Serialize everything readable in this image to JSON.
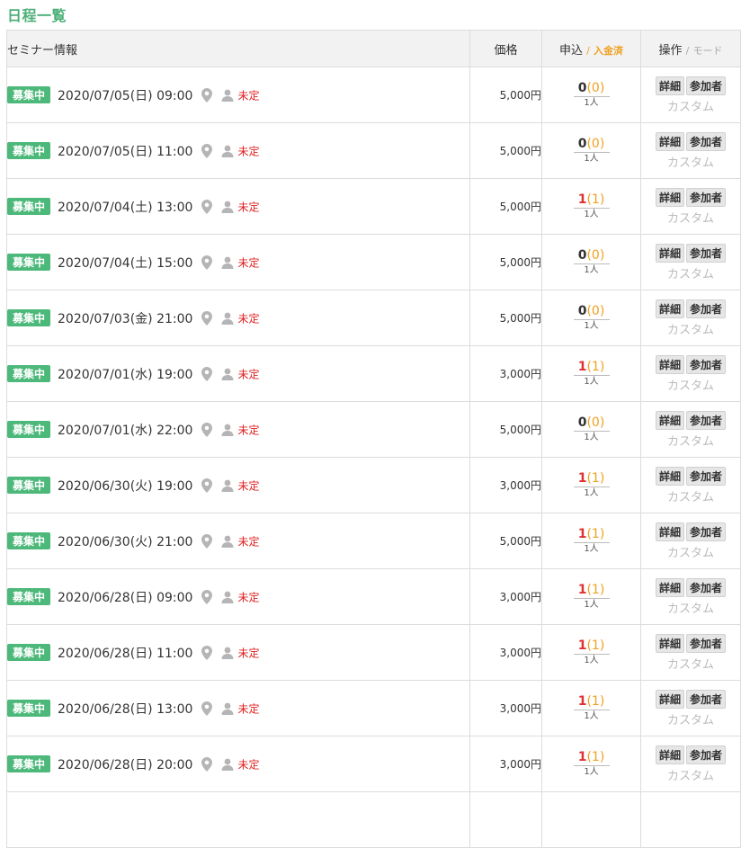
{
  "page": {
    "title": "日程一覧"
  },
  "table": {
    "headers": {
      "info": "セミナー情報",
      "price": "価格",
      "apply": "申込",
      "apply_slash": "/",
      "paid": "入金済",
      "ops": "操作",
      "ops_slash": "/",
      "mode": "モード"
    },
    "rows": [
      {
        "status": "募集中",
        "datetime": "2020/07/05(日) 09:00",
        "instructor": "未定",
        "price": "5,000円",
        "applied": "0",
        "paid": "(0)",
        "unit": "1人"
      },
      {
        "status": "募集中",
        "datetime": "2020/07/05(日) 11:00",
        "instructor": "未定",
        "price": "5,000円",
        "applied": "0",
        "paid": "(0)",
        "unit": "1人"
      },
      {
        "status": "募集中",
        "datetime": "2020/07/04(土) 13:00",
        "instructor": "未定",
        "price": "5,000円",
        "applied": "1",
        "paid": "(1)",
        "unit": "1人"
      },
      {
        "status": "募集中",
        "datetime": "2020/07/04(土) 15:00",
        "instructor": "未定",
        "price": "5,000円",
        "applied": "0",
        "paid": "(0)",
        "unit": "1人"
      },
      {
        "status": "募集中",
        "datetime": "2020/07/03(金) 21:00",
        "instructor": "未定",
        "price": "5,000円",
        "applied": "0",
        "paid": "(0)",
        "unit": "1人"
      },
      {
        "status": "募集中",
        "datetime": "2020/07/01(水) 19:00",
        "instructor": "未定",
        "price": "3,000円",
        "applied": "1",
        "paid": "(1)",
        "unit": "1人"
      },
      {
        "status": "募集中",
        "datetime": "2020/07/01(水) 22:00",
        "instructor": "未定",
        "price": "5,000円",
        "applied": "0",
        "paid": "(0)",
        "unit": "1人"
      },
      {
        "status": "募集中",
        "datetime": "2020/06/30(火) 19:00",
        "instructor": "未定",
        "price": "3,000円",
        "applied": "1",
        "paid": "(1)",
        "unit": "1人"
      },
      {
        "status": "募集中",
        "datetime": "2020/06/30(火) 21:00",
        "instructor": "未定",
        "price": "5,000円",
        "applied": "1",
        "paid": "(1)",
        "unit": "1人"
      },
      {
        "status": "募集中",
        "datetime": "2020/06/28(日) 09:00",
        "instructor": "未定",
        "price": "3,000円",
        "applied": "1",
        "paid": "(1)",
        "unit": "1人"
      },
      {
        "status": "募集中",
        "datetime": "2020/06/28(日) 11:00",
        "instructor": "未定",
        "price": "3,000円",
        "applied": "1",
        "paid": "(1)",
        "unit": "1人"
      },
      {
        "status": "募集中",
        "datetime": "2020/06/28(日) 13:00",
        "instructor": "未定",
        "price": "3,000円",
        "applied": "1",
        "paid": "(1)",
        "unit": "1人"
      },
      {
        "status": "募集中",
        "datetime": "2020/06/28(日) 20:00",
        "instructor": "未定",
        "price": "3,000円",
        "applied": "1",
        "paid": "(1)",
        "unit": "1人"
      },
      {
        "status": "",
        "datetime": "",
        "instructor": "",
        "price": "",
        "applied": "",
        "paid": "",
        "unit": ""
      }
    ],
    "buttons": {
      "detail": "詳細",
      "participants": "参加者",
      "custom": "カスタム"
    }
  },
  "icons": {
    "location": "map-pin-icon",
    "instructor": "person-icon"
  },
  "colors": {
    "title": "#4caf78",
    "badge": "#4cb87a",
    "instructor": "#e02020",
    "count_one": "#e03030",
    "paid": "#f0a020"
  }
}
